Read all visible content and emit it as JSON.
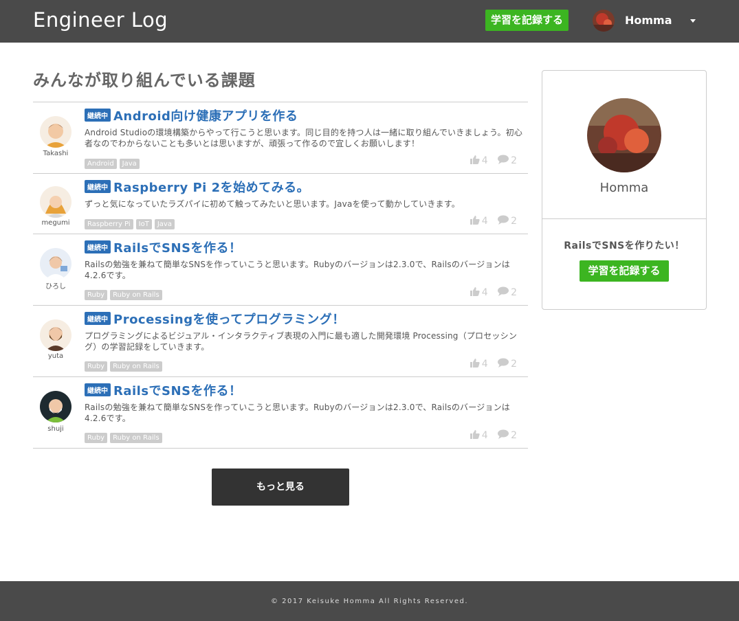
{
  "header": {
    "logo": "Engineer Log",
    "record_button": "学習を記録する",
    "user_name": "Homma"
  },
  "main": {
    "title": "みんなが取り組んでいる課題",
    "items": [
      {
        "user": "Takashi",
        "status": "継続中",
        "title": "Android向け健康アプリを作る",
        "description": "Android Studioの環境構築からやって行こうと思います。同じ目的を持つ人は一緒に取り組んでいきましょう。初心者なのでわからないことも多いとは思いますが、頑張って作るので宜しくお願いします！",
        "tags": [
          "Android",
          "Java"
        ],
        "likes": "4",
        "comments": "2"
      },
      {
        "user": "megumi",
        "status": "継続中",
        "title": "Raspberry Pi 2を始めてみる。",
        "description": "ずっと気になっていたラズパイに初めて触ってみたいと思います。Javaを使って動かしていきます。",
        "tags": [
          "Raspberry Pi",
          "IoT",
          "Java"
        ],
        "likes": "4",
        "comments": "2"
      },
      {
        "user": "ひろし",
        "status": "継続中",
        "title": "RailsでSNSを作る！",
        "description": "Railsの勉強を兼ねて簡単なSNSを作っていこうと思います。Rubyのバージョンは2.3.0で、Railsのバージョンは4.2.6です。",
        "tags": [
          "Ruby",
          "Ruby on Rails"
        ],
        "likes": "4",
        "comments": "2"
      },
      {
        "user": "yuta",
        "status": "継続中",
        "title": "Processingを使ってプログラミング！",
        "description": "プログラミングによるビジュアル・インタラクティブ表現の入門に最も適した開発環境 Processing（プロセッシング）の学習記録をしていきます。",
        "tags": [
          "Ruby",
          "Ruby on Rails"
        ],
        "likes": "4",
        "comments": "2"
      },
      {
        "user": "shuji",
        "status": "継続中",
        "title": "RailsでSNSを作る！",
        "description": "Railsの勉強を兼ねて簡単なSNSを作っていこうと思います。Rubyのバージョンは2.3.0で、Railsのバージョンは4.2.6です。",
        "tags": [
          "Ruby",
          "Ruby on Rails"
        ],
        "likes": "4",
        "comments": "2"
      }
    ],
    "more_button": "もっと見る"
  },
  "sidebar": {
    "user_name": "Homma",
    "goal": "RailsでSNSを作りたい！",
    "record_button": "学習を記録する"
  },
  "footer": {
    "copyright": "© 2017 Keisuke Homma All Rights Reserved."
  },
  "colors": {
    "header_bg": "#4a4a4a",
    "accent_green": "#3cb521",
    "link_blue": "#2c6fb7",
    "tag_gray": "#cccccc"
  }
}
